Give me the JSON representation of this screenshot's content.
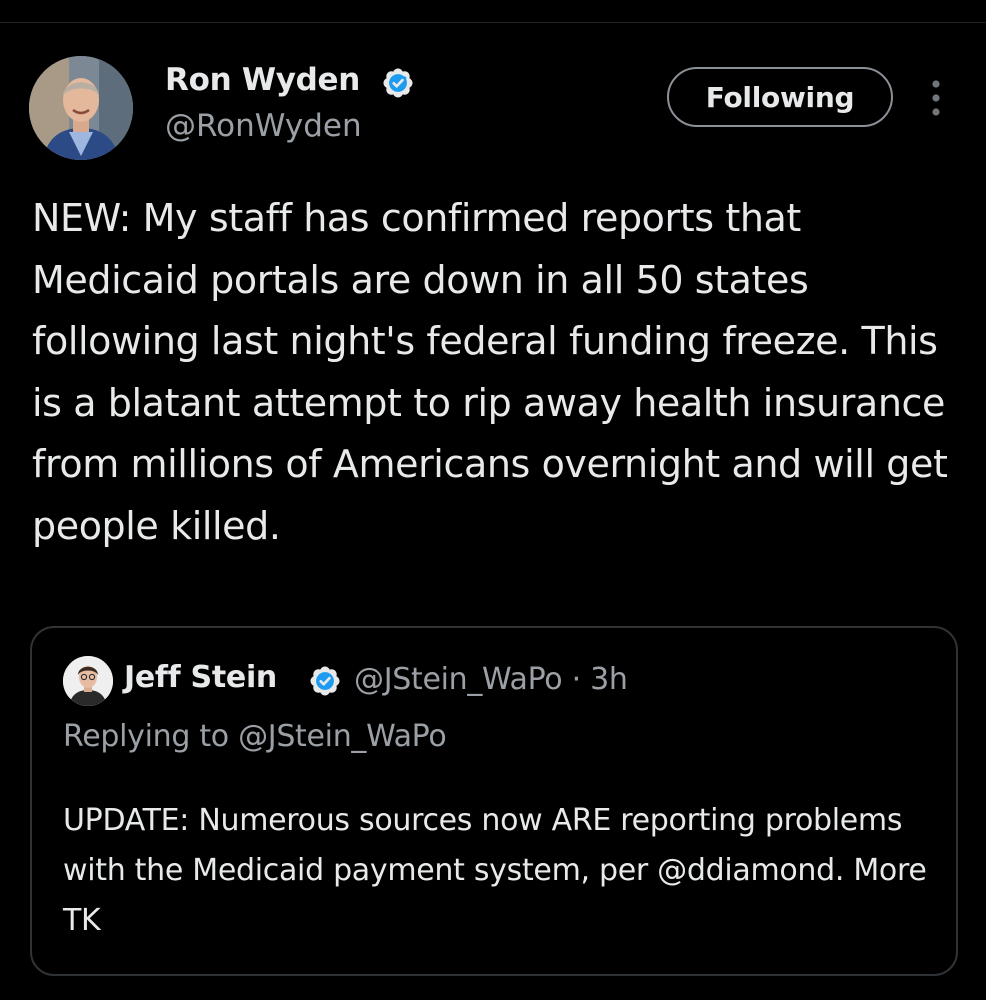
{
  "tweet": {
    "author": {
      "name": "Ron Wyden",
      "handle": "@RonWyden",
      "verified": true
    },
    "follow_button_label": "Following",
    "more_icon": "more-vertical-icon",
    "text": "NEW: My staff has confirmed reports that Medicaid portals are down in all 50 states following last night's federal funding freeze. This is a blatant attempt to rip away health insurance from millions of Americans overnight and will get people killed."
  },
  "quoted_tweet": {
    "author": {
      "name": "Jeff Stein",
      "handle": "@JStein_WaPo",
      "verified": true
    },
    "meta": "@JStein_WaPo · 3h",
    "replying_to": "Replying to @JStein_WaPo",
    "text": "UPDATE: Numerous sources now ARE reporting problems with the Medicaid payment system, per @ddiamond. More TK"
  },
  "colors": {
    "background": "#000000",
    "primary_text": "#e7e9ea",
    "secondary_text": "#9aa0a6",
    "verified_badge": "#1d9bf0",
    "border": "#2f3336"
  }
}
